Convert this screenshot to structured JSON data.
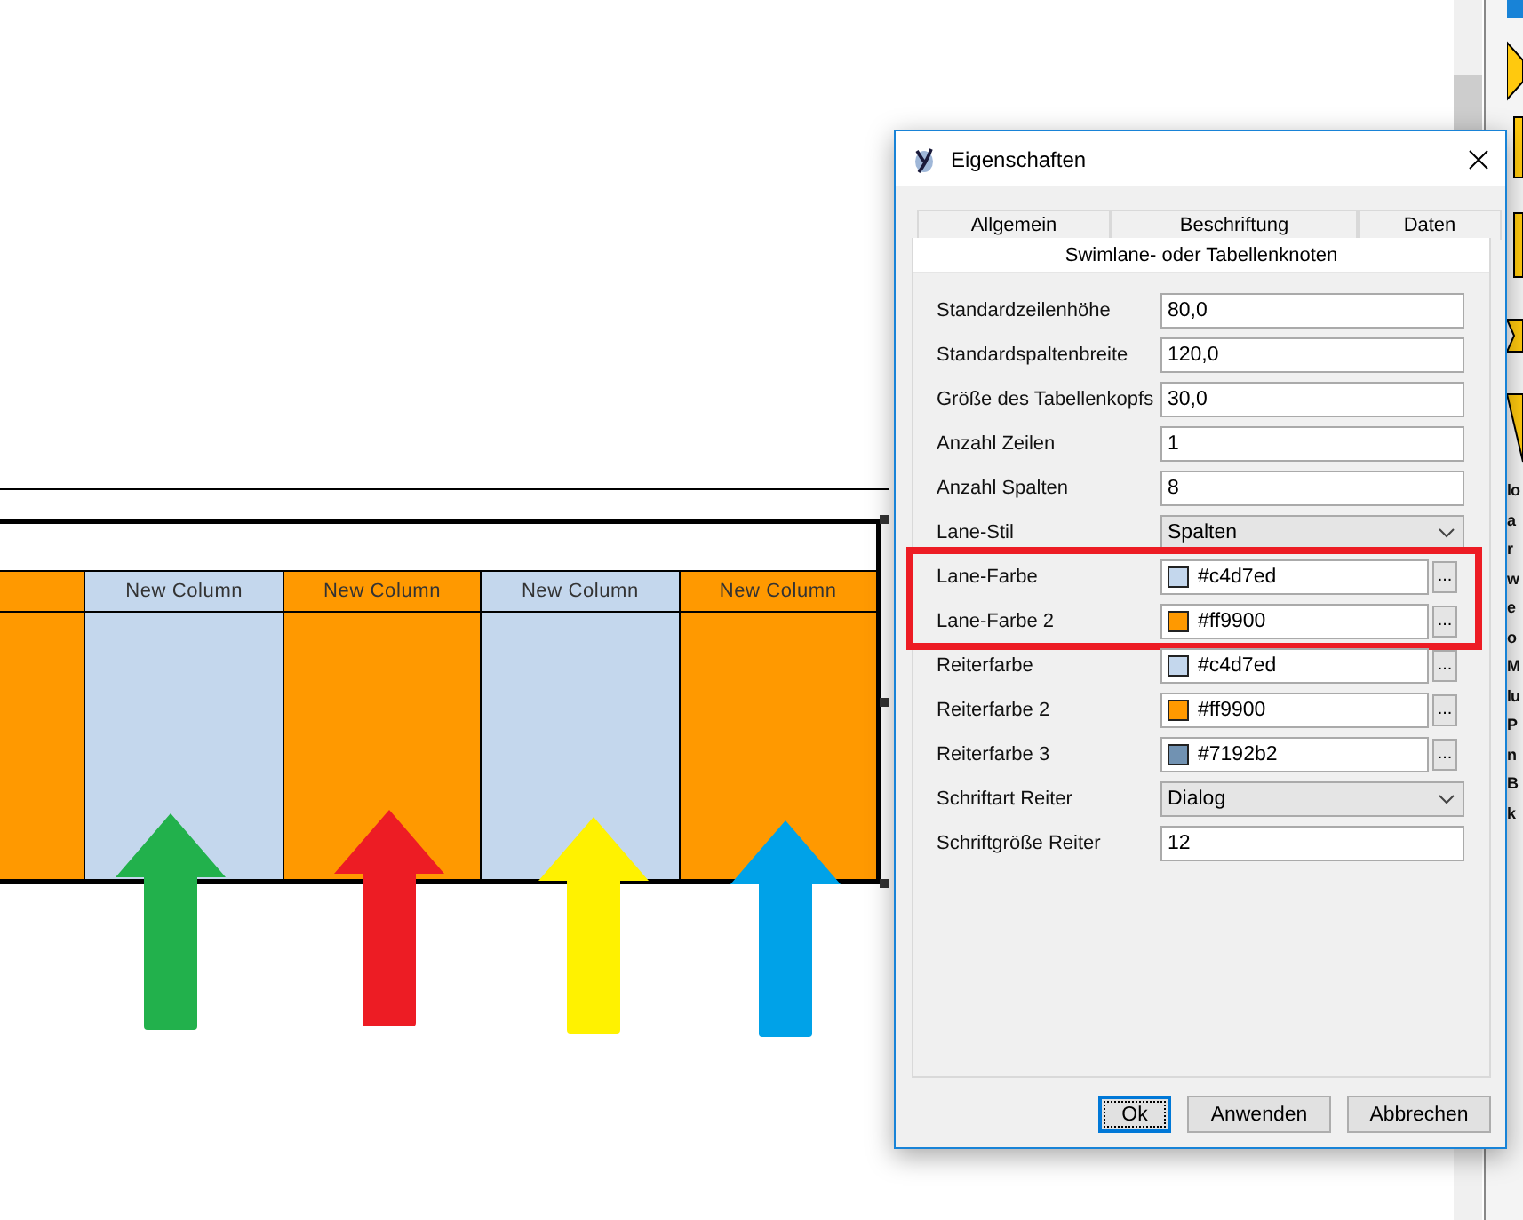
{
  "swimlane": {
    "columns": [
      {
        "color": "#ff9900"
      },
      {
        "label": "New Column",
        "color": "#c4d7ed"
      },
      {
        "label": "New Column",
        "color": "#ff9900"
      },
      {
        "label": "New Column",
        "color": "#c4d7ed"
      },
      {
        "label": "New Column",
        "color": "#ff9900"
      }
    ]
  },
  "arrows": [
    {
      "color": "#22b14c"
    },
    {
      "color": "#ed1c24"
    },
    {
      "color": "#fff200"
    },
    {
      "color": "#00a2e8"
    }
  ],
  "side_panel": {
    "labels": [
      "lo",
      "a",
      "r",
      "w",
      "e",
      "o",
      "M",
      "lu",
      "P",
      "n",
      "B",
      "k"
    ]
  },
  "dialog": {
    "title": "Eigenschaften",
    "tabs": [
      {
        "label": "Allgemein",
        "selected": false
      },
      {
        "label": "Beschriftung",
        "selected": false
      },
      {
        "label": "Daten",
        "selected": false
      },
      {
        "label": "Swimlane- oder Tabellenknoten",
        "selected": true
      }
    ],
    "properties": [
      {
        "label": "Standardzeilenhöhe",
        "kind": "text",
        "value": "80,0",
        "highlighted": false
      },
      {
        "label": "Standardspaltenbreite",
        "kind": "text",
        "value": "120,0",
        "highlighted": false
      },
      {
        "label": "Größe des Tabellenkopfs",
        "kind": "text",
        "value": "30,0",
        "highlighted": false
      },
      {
        "label": "Anzahl Zeilen",
        "kind": "text",
        "value": "1",
        "highlighted": false
      },
      {
        "label": "Anzahl Spalten",
        "kind": "text",
        "value": "8",
        "highlighted": false
      },
      {
        "label": "Lane-Stil",
        "kind": "select",
        "value": "Spalten",
        "highlighted": false
      },
      {
        "label": "Lane-Farbe",
        "kind": "color",
        "value": "#c4d7ed",
        "color": "#c4d7ed",
        "button": "...",
        "highlighted": true
      },
      {
        "label": "Lane-Farbe 2",
        "kind": "color",
        "value": "#ff9900",
        "color": "#ff9900",
        "button": "...",
        "highlighted": true
      },
      {
        "label": "Reiterfarbe",
        "kind": "color",
        "value": "#c4d7ed",
        "color": "#c4d7ed",
        "button": "...",
        "highlighted": false
      },
      {
        "label": "Reiterfarbe 2",
        "kind": "color",
        "value": "#ff9900",
        "color": "#ff9900",
        "button": "...",
        "highlighted": false
      },
      {
        "label": "Reiterfarbe 3",
        "kind": "color",
        "value": "#7192b2",
        "color": "#7192b2",
        "button": "...",
        "highlighted": false
      },
      {
        "label": "Schriftart Reiter",
        "kind": "select",
        "value": "Dialog",
        "highlighted": false
      },
      {
        "label": "Schriftgröße Reiter",
        "kind": "text",
        "value": "12",
        "highlighted": false
      }
    ],
    "buttons": [
      {
        "label": "Ok",
        "focused": true
      },
      {
        "label": "Anwenden",
        "focused": false
      },
      {
        "label": "Abbrechen",
        "focused": false
      }
    ]
  }
}
